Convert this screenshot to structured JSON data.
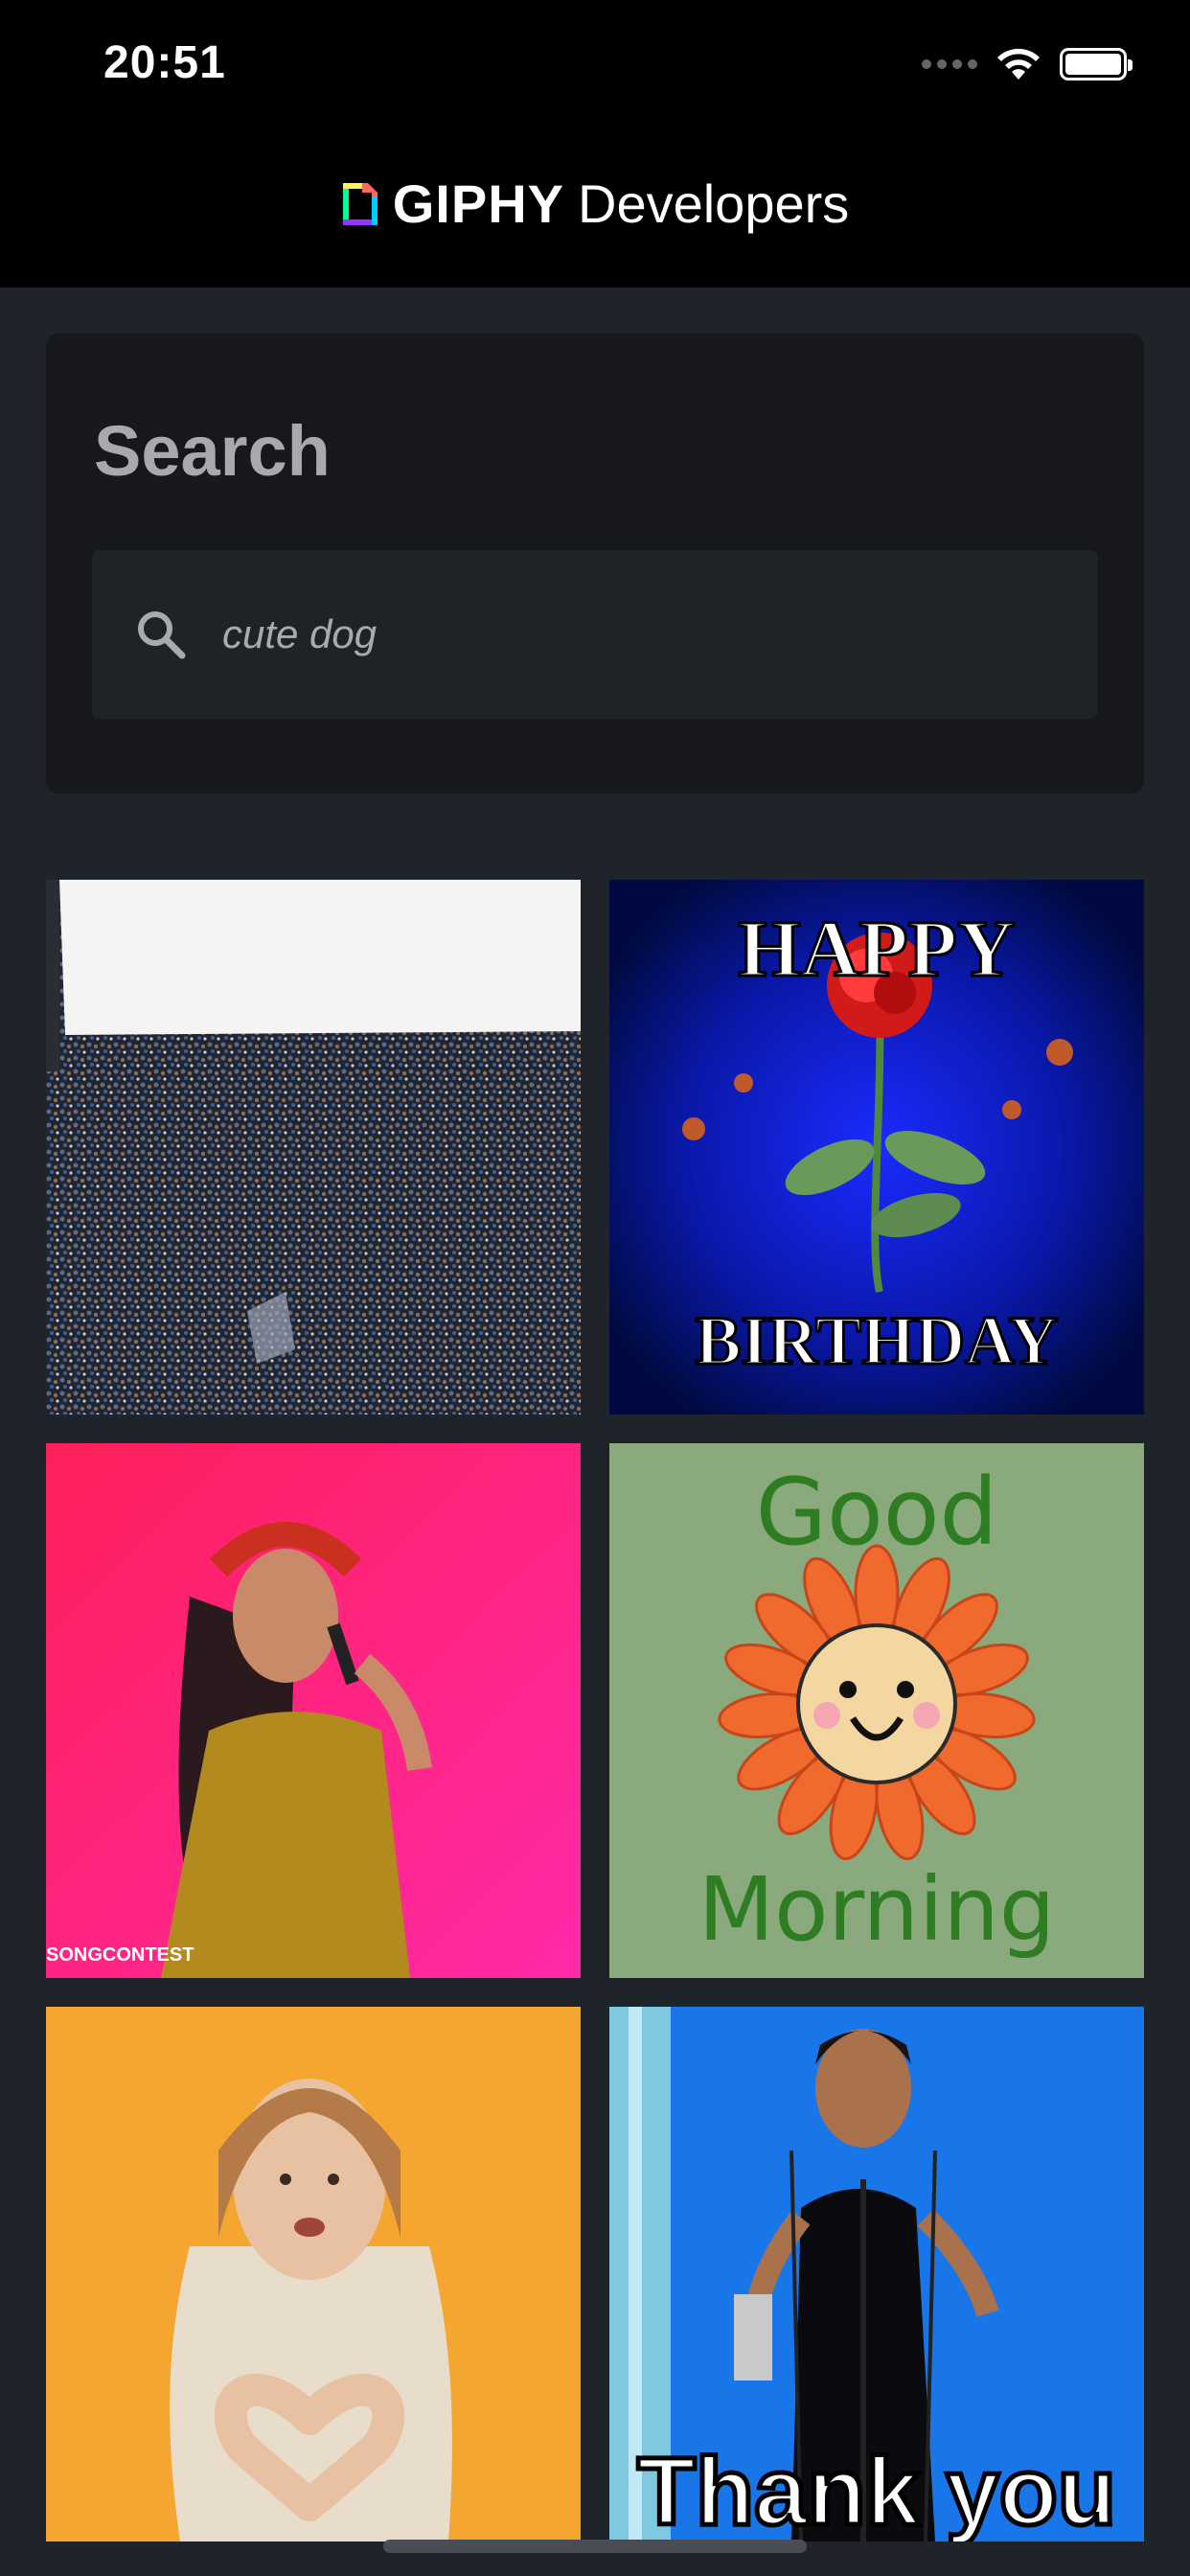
{
  "status_bar": {
    "time": "20:51"
  },
  "header": {
    "brand": "GIPHY",
    "subtitle": "Developers"
  },
  "search": {
    "title": "Search",
    "query": "cute dog"
  },
  "gifs": [
    {
      "name": "stadium-crowd",
      "overlay_text": ""
    },
    {
      "name": "happy-birthday-rose",
      "top_text": "HAPPY",
      "bottom_text": "BIRTHDAY"
    },
    {
      "name": "singer-flower-crown",
      "overlay_text": "SONGCONTEST"
    },
    {
      "name": "good-morning-flower",
      "top_text": "Good",
      "bottom_text": "Morning"
    },
    {
      "name": "heart-hands",
      "overlay_text": ""
    },
    {
      "name": "thank-you-award",
      "overlay_text": "Thank you"
    }
  ],
  "colors": {
    "background": "#1f232a",
    "card": "#16181c",
    "topbar": "#000000"
  }
}
